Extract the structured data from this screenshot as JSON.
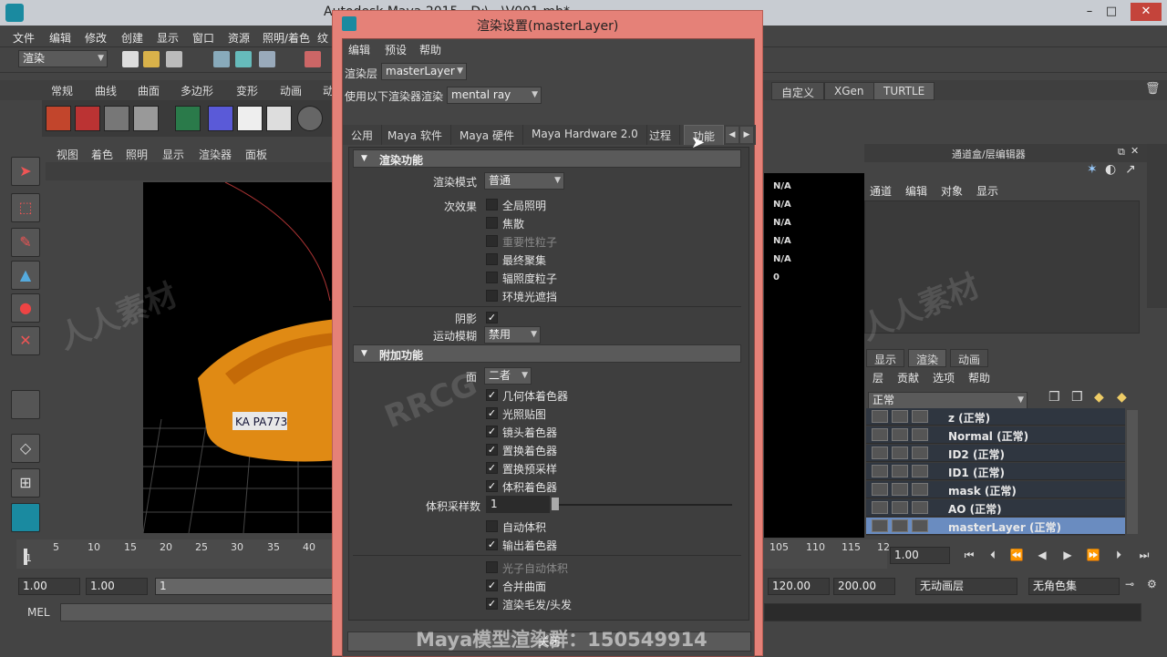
{
  "window": {
    "title": "Autodesk Maya 2015 - D:\\...\\V001.mb*",
    "min": "–",
    "max": "□",
    "close": "✕"
  },
  "menubar": [
    "文件",
    "编辑",
    "修改",
    "创建",
    "显示",
    "窗口",
    "资源",
    "照明/着色",
    "纹"
  ],
  "status": {
    "menuset": "渲染"
  },
  "shelf_tabs": [
    "常规",
    "曲线",
    "曲面",
    "多边形",
    "变形",
    "动画",
    "动"
  ],
  "shelf_tabs_right": [
    "自定义",
    "XGen",
    "TURTLE"
  ],
  "viewport_menu": [
    "视图",
    "着色",
    "照明",
    "显示",
    "渲染器",
    "面板"
  ],
  "plate": "KA PA773",
  "hud_values": [
    "N/A",
    "N/A",
    "N/A",
    "N/A",
    "N/A",
    "0"
  ],
  "channel_box": {
    "title": "通道盒/层编辑器",
    "menu": [
      "通道",
      "编辑",
      "对象",
      "显示"
    ]
  },
  "layer_editor": {
    "tabs": [
      "显示",
      "渲染",
      "动画"
    ],
    "menu": [
      "层",
      "贡献",
      "选项",
      "帮助"
    ],
    "mode": "正常",
    "layers": [
      "z (正常)",
      "Normal (正常)",
      "ID2 (正常)",
      "ID1 (正常)",
      "mask (正常)",
      "AO (正常)",
      "masterLayer (正常)"
    ]
  },
  "timeline": {
    "ticks": [
      "1",
      "5",
      "10",
      "15",
      "20",
      "25",
      "30",
      "35",
      "40"
    ],
    "ticks_right": [
      "105",
      "110",
      "115",
      "12"
    ],
    "current": "1.00"
  },
  "range": {
    "start": "1.00",
    "start2": "1.00",
    "frame": "1",
    "end": "120.00",
    "end2": "200.00",
    "anim_layer": "无动画层",
    "char_set": "无角色集"
  },
  "mel": {
    "label": "MEL"
  },
  "dialog": {
    "title": "渲染设置(masterLayer)",
    "menu": [
      "编辑",
      "预设",
      "帮助"
    ],
    "render_layer_label": "渲染层",
    "render_layer": "masterLayer",
    "renderer_label": "使用以下渲染器渲染",
    "renderer": "mental ray",
    "tabs": [
      "公用",
      "Maya 软件",
      "Maya 硬件",
      "Maya Hardware 2.0",
      "过程",
      "功能"
    ],
    "sections": {
      "render_features": "渲染功能",
      "extra_features": "附加功能"
    },
    "render_mode_label": "渲染模式",
    "render_mode": "普通",
    "secondary_label": "次效果",
    "secondary": [
      {
        "label": "全局照明",
        "checked": false,
        "dim": false
      },
      {
        "label": "焦散",
        "checked": false,
        "dim": false
      },
      {
        "label": "重要性粒子",
        "checked": false,
        "dim": true
      },
      {
        "label": "最终聚集",
        "checked": false,
        "dim": false
      },
      {
        "label": "辐照度粒子",
        "checked": false,
        "dim": false
      },
      {
        "label": "环境光遮挡",
        "checked": false,
        "dim": false
      }
    ],
    "shadows_label": "阴影",
    "motion_blur_label": "运动模糊",
    "motion_blur": "禁用",
    "faces_label": "面",
    "faces": "二者",
    "extra": [
      {
        "label": "几何体着色器",
        "checked": true
      },
      {
        "label": "光照贴图",
        "checked": true
      },
      {
        "label": "镜头着色器",
        "checked": true
      },
      {
        "label": "置换着色器",
        "checked": true
      },
      {
        "label": "置换预采样",
        "checked": true
      },
      {
        "label": "体积着色器",
        "checked": true
      }
    ],
    "volume_samples_label": "体积采样数",
    "volume_samples": "1",
    "extra2": [
      {
        "label": "自动体积",
        "checked": false,
        "dim": false
      },
      {
        "label": "输出着色器",
        "checked": true,
        "dim": false
      },
      {
        "label": "光子自动体积",
        "checked": false,
        "dim": true
      },
      {
        "label": "合并曲面",
        "checked": true,
        "dim": false
      },
      {
        "label": "渲染毛发/头发",
        "checked": true,
        "dim": false
      }
    ],
    "close_btn": "关闭"
  },
  "watermark": "Maya模型渲染群：150549914"
}
